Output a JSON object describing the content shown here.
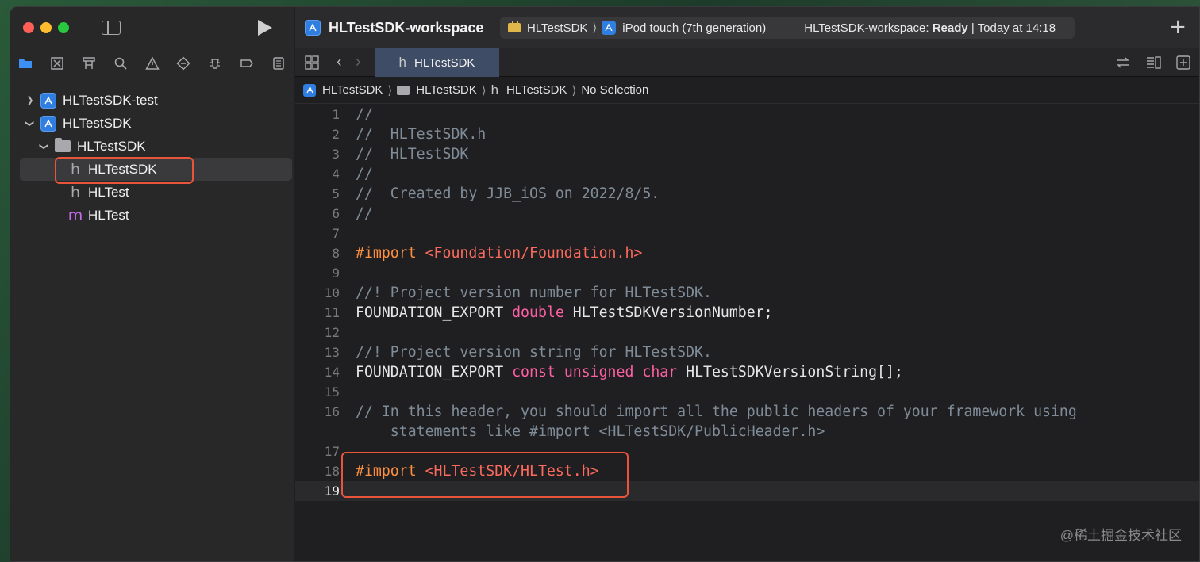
{
  "window": {
    "title": "HLTestSDK-workspace"
  },
  "scheme": {
    "target": "HLTestSDK",
    "device": "iPod touch (7th generation)",
    "status_prefix": "HLTestSDK-workspace: ",
    "status_state": "Ready",
    "status_suffix": " | Today at 14:18"
  },
  "navigator": {
    "icons": [
      "folder-icon",
      "source-control-icon",
      "symbol-icon",
      "find-icon",
      "issue-icon",
      "test-icon",
      "debug-icon",
      "breakpoint-icon",
      "report-icon"
    ],
    "tree": [
      {
        "label": "HLTestSDK-test",
        "kind": "project",
        "expanded": false,
        "depth": 0
      },
      {
        "label": "HLTestSDK",
        "kind": "project",
        "expanded": true,
        "depth": 0
      },
      {
        "label": "HLTestSDK",
        "kind": "folder",
        "expanded": true,
        "depth": 1
      },
      {
        "label": "HLTestSDK",
        "kind": "h",
        "depth": 2,
        "selected": true
      },
      {
        "label": "HLTest",
        "kind": "h",
        "depth": 2
      },
      {
        "label": "HLTest",
        "kind": "m",
        "depth": 2
      }
    ]
  },
  "editor": {
    "tab_label": "HLTestSDK",
    "breadcrumb": [
      "HLTestSDK",
      "HLTestSDK",
      "HLTestSDK",
      "No Selection"
    ],
    "lines": [
      {
        "n": "1",
        "segs": [
          [
            "comment",
            "//"
          ]
        ]
      },
      {
        "n": "2",
        "segs": [
          [
            "comment",
            "//  HLTestSDK.h"
          ]
        ]
      },
      {
        "n": "3",
        "segs": [
          [
            "comment",
            "//  HLTestSDK"
          ]
        ]
      },
      {
        "n": "4",
        "segs": [
          [
            "comment",
            "//"
          ]
        ]
      },
      {
        "n": "5",
        "segs": [
          [
            "comment",
            "//  Created by JJB_iOS on 2022/8/5."
          ]
        ]
      },
      {
        "n": "6",
        "segs": [
          [
            "comment",
            "//"
          ]
        ]
      },
      {
        "n": "7",
        "segs": []
      },
      {
        "n": "8",
        "segs": [
          [
            "pre",
            "#import "
          ],
          [
            "str",
            "<Foundation/Foundation.h>"
          ]
        ]
      },
      {
        "n": "9",
        "segs": []
      },
      {
        "n": "10",
        "segs": [
          [
            "comment",
            "//! Project version number for HLTestSDK."
          ]
        ]
      },
      {
        "n": "11",
        "segs": [
          [
            "plain",
            "FOUNDATION_EXPORT "
          ],
          [
            "kw",
            "double"
          ],
          [
            "plain",
            " HLTestSDKVersionNumber;"
          ]
        ]
      },
      {
        "n": "12",
        "segs": []
      },
      {
        "n": "13",
        "segs": [
          [
            "comment",
            "//! Project version string for HLTestSDK."
          ]
        ]
      },
      {
        "n": "14",
        "segs": [
          [
            "plain",
            "FOUNDATION_EXPORT "
          ],
          [
            "kw",
            "const"
          ],
          [
            "plain",
            " "
          ],
          [
            "kw",
            "unsigned"
          ],
          [
            "plain",
            " "
          ],
          [
            "kw",
            "char"
          ],
          [
            "plain",
            " HLTestSDKVersionString[];"
          ]
        ]
      },
      {
        "n": "15",
        "segs": []
      },
      {
        "n": "16",
        "segs": [
          [
            "comment",
            "// In this header, you should import all the public headers of your framework using"
          ]
        ]
      },
      {
        "n": "",
        "segs": [
          [
            "comment",
            "    statements like #import <HLTestSDK/PublicHeader.h>"
          ]
        ]
      },
      {
        "n": "17",
        "segs": []
      },
      {
        "n": "18",
        "segs": [
          [
            "pre",
            "#import "
          ],
          [
            "str",
            "<HLTestSDK/HLTest.h>"
          ]
        ]
      },
      {
        "n": "19",
        "segs": [],
        "current": true
      }
    ]
  },
  "watermark": "@稀土掘金技术社区",
  "colors": {
    "accent": "#2f7ee0",
    "highlight": "#e8553a",
    "comment": "#7f8c98",
    "preprocessor": "#fd8f3f",
    "string": "#fc6a5d",
    "keyword": "#fc5fa3"
  }
}
